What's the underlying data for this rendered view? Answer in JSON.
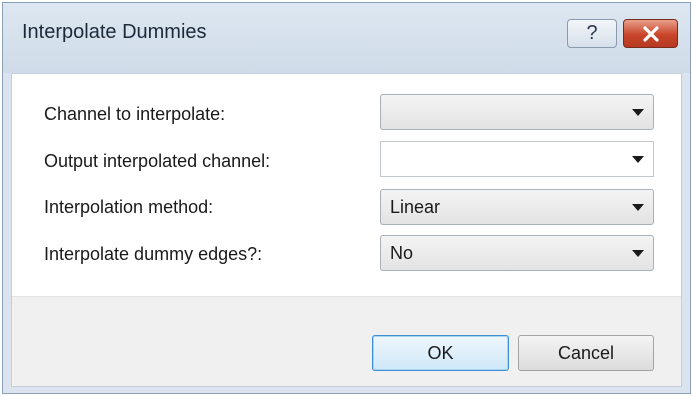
{
  "window": {
    "title": "Interpolate Dummies",
    "help_glyph": "?",
    "close_icon": "close-icon"
  },
  "form": {
    "fields": [
      {
        "label": "Channel to interpolate:",
        "value": "",
        "type": "dropdown"
      },
      {
        "label": "Output interpolated channel:",
        "value": "",
        "type": "editable-combo"
      },
      {
        "label": "Interpolation method:",
        "value": "Linear",
        "type": "dropdown"
      },
      {
        "label": "Interpolate dummy edges?:",
        "value": "No",
        "type": "dropdown"
      }
    ]
  },
  "buttons": {
    "ok_label": "OK",
    "cancel_label": "Cancel"
  },
  "colors": {
    "titlebar": "#d4dfeb",
    "close_button": "#c9452a",
    "default_button_border": "#3c8fd4"
  }
}
